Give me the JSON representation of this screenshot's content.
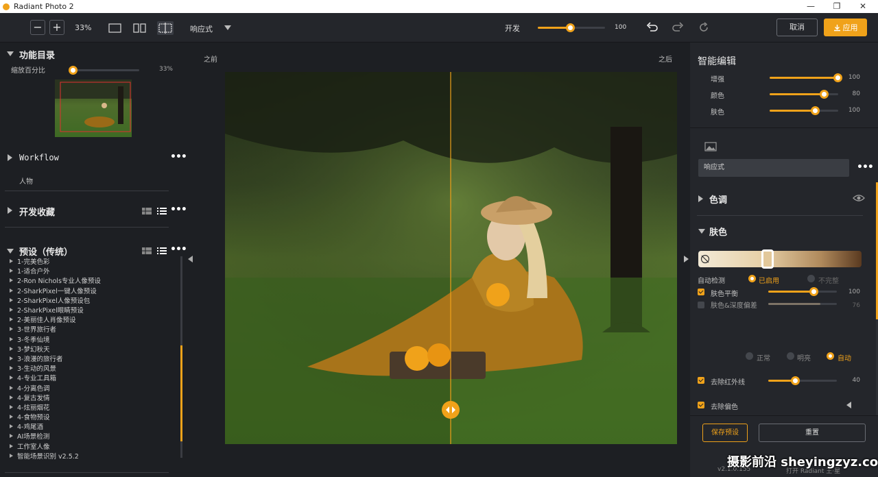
{
  "app": {
    "title": "Radiant Photo 2"
  },
  "window": {
    "minimize": "—",
    "maximize": "❐",
    "close": "✕"
  },
  "toolbar": {
    "zoom_out": "−",
    "zoom_in": "+",
    "zoom_level": "33%",
    "view_mode": "响应式",
    "strength_label": "开发",
    "strength_value": "100",
    "strength_fraction": 0.48,
    "cancel_label": "取消",
    "apply_label": "应用"
  },
  "left": {
    "function_dir": "功能目录",
    "zoom_pct_label": "缩放百分比",
    "zoom_pct_value": "33%",
    "workflow_title": "Workflow",
    "workflow_item": "人物",
    "dev_favorites": "开发收藏",
    "presets_title": "预设（传统）",
    "presets": [
      "1-完美色彩",
      "1-适合户外",
      "2-Ron Nichols专业人像预设",
      "2-SharkPixel一键人像预设",
      "2-SharkPixel人像预设包",
      "2-SharkPixel眼睛预设",
      "2-美丽佳人肖像预设",
      "3-世界旅行者",
      "3-冬季仙境",
      "3-梦幻秋天",
      "3-浪漫的旅行者",
      "3-生动的风景",
      "4-专业工具箱",
      "4-分离色调",
      "4-复古发情",
      "4-炫丽烟花",
      "4-食物预设",
      "4-鸡尾酒",
      "AI场景检测",
      "工作室人像",
      "智能场景识别 v2.5.2"
    ]
  },
  "center": {
    "before_label": "之前",
    "after_label": "之后"
  },
  "right": {
    "smart_edit_title": "智能编辑",
    "sliders": [
      {
        "label": "增强",
        "value": "100",
        "fraction": 1.0
      },
      {
        "label": "颜色",
        "value": "80",
        "fraction": 0.8
      },
      {
        "label": "肤色",
        "value": "100",
        "fraction": 0.67
      }
    ],
    "preset_select": "响应式",
    "tone_title": "色调",
    "skin_title": "肤色",
    "auto_detect_label": "自动检测",
    "auto_detect_on": "已启用",
    "auto_detect_off": "不完整",
    "skin_balance_label": "肤色平衡",
    "skin_balance_value": "100",
    "skin_balance_fraction": 0.67,
    "skin_depth_label": "肤色&深度偏差",
    "skin_depth_value": "76",
    "skin_depth_fraction": 0.76,
    "mode_normal": "正常",
    "mode_bright": "明亮",
    "mode_auto": "自动",
    "remove_ir_label": "去除红外线",
    "remove_ir_value": "40",
    "remove_ir_fraction": 0.4,
    "remove_cast_label": "去除偏色",
    "save_preset": "保存预设",
    "reset": "重置"
  },
  "footer": {
    "version": "v2.1.0.155",
    "open_text": "打开 Radiant 王·星"
  },
  "watermark": "摄影前沿 sheyingzyz.com",
  "colors": {
    "accent": "#f0a21a",
    "bg": "#1d1f23",
    "panel": "#24262b"
  }
}
